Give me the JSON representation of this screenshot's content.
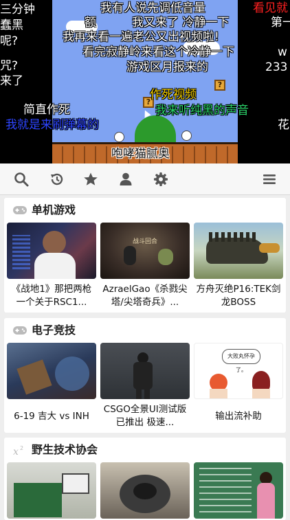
{
  "player": {
    "danmaku": [
      {
        "text": "三分钟",
        "color": "#ffffff"
      },
      {
        "text": "蠢黑",
        "color": "#ffffff"
      },
      {
        "text": "呢?",
        "color": "#ffffff"
      },
      {
        "text": "咒?",
        "color": "#ffffff"
      },
      {
        "text": "来了",
        "color": "#ffffff"
      },
      {
        "text": "我有人说先调低音量",
        "color": "#ffffff"
      },
      {
        "text": "看见就",
        "color": "#ff2020"
      },
      {
        "text": "额",
        "color": "#ffffff"
      },
      {
        "text": "我又来了  冷静一下",
        "color": "#ffffff"
      },
      {
        "text": "第一",
        "color": "#ffffff"
      },
      {
        "text": "我再来看一遍老公又出视频啦!",
        "color": "#ffffff"
      },
      {
        "text": "看完寂静岭来看这个冷静一下",
        "color": "#ffffff"
      },
      {
        "text": "w",
        "color": "#ffffff"
      },
      {
        "text": "233",
        "color": "#ffffff"
      },
      {
        "text": "游戏区月报来的",
        "color": "#ffffff"
      },
      {
        "text": "作死视频",
        "color": "#f5d000"
      },
      {
        "text": "简直作死",
        "color": "#ffffff"
      },
      {
        "text": "我来听纯黑的声音",
        "color": "#2bd36a"
      },
      {
        "text": "我就是来刷弹幕的",
        "color": "#2d45ff"
      },
      {
        "text": "花",
        "color": "#ffffff"
      },
      {
        "text": "咆哮猫腻奥",
        "color": "#111111"
      }
    ]
  },
  "toolbar": {
    "icons": [
      "search-icon",
      "history-icon",
      "star-icon",
      "user-icon",
      "gear-icon",
      "menu-icon"
    ]
  },
  "sections": [
    {
      "icon": "gamepad-icon",
      "title": "单机游戏",
      "cards": [
        {
          "title": "《战地1》那把两枪一个关于RSC1...",
          "thumb_text": ""
        },
        {
          "title": "AzraelGao《杀戮尖塔/尖塔奇兵》...",
          "thumb_text": "战斗回合"
        },
        {
          "title": "方舟灭绝P16:TEK剑龙BOSS",
          "thumb_text": ""
        }
      ]
    },
    {
      "icon": "gamepad-icon",
      "title": "电子竞技",
      "cards": [
        {
          "title": "6-19 吉大 vs INH",
          "thumb_text": ""
        },
        {
          "title": "CSGO全景UI测试版已推出 极速...",
          "thumb_text": ""
        },
        {
          "title": "输出流补助",
          "thumb_text": "大败丸怀孕了。"
        }
      ]
    },
    {
      "icon": "x-squared-icon",
      "title": "野生技术协会",
      "cards": [
        {
          "title": "",
          "thumb_text": ""
        },
        {
          "title": "",
          "thumb_text": ""
        },
        {
          "title": "",
          "thumb_text": ""
        }
      ]
    }
  ],
  "colors": {
    "toolbar_icon": "#555555",
    "section_icon": "#bbbbbb",
    "page_bg": "#eeeeee"
  }
}
